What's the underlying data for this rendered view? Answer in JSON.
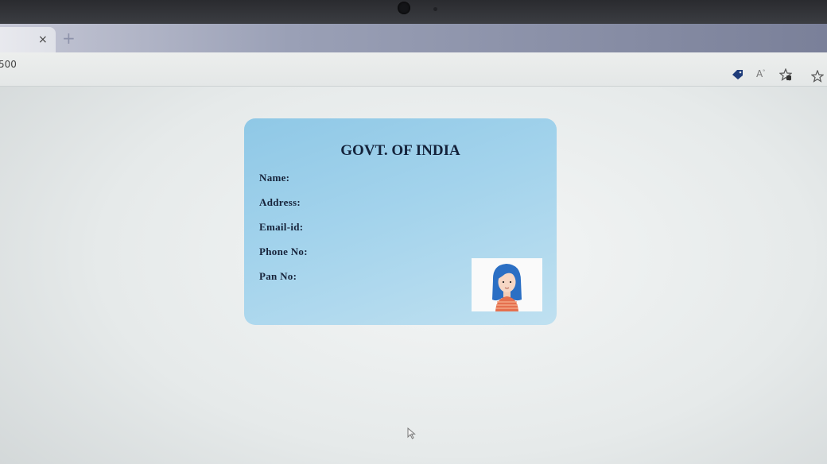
{
  "browser": {
    "tab_close_glyph": "×",
    "new_tab_glyph": "+",
    "url_text": "500",
    "toolbar_icons": [
      "tag-icon",
      "read-aloud-icon",
      "favorite-icon",
      "collections-icon"
    ],
    "read_aloud_text": "A"
  },
  "card": {
    "title": "GOVT. OF INDIA",
    "fields": [
      "Name:",
      "Address:",
      "Email-id:",
      "Phone No:",
      "Pan No:"
    ],
    "photo_alt": "avatar-girl"
  },
  "colors": {
    "card_top": "#8fc8e6",
    "card_bottom": "#bfe0f0",
    "title_text": "#14223a",
    "tab_bar": "#9aa0b6"
  }
}
